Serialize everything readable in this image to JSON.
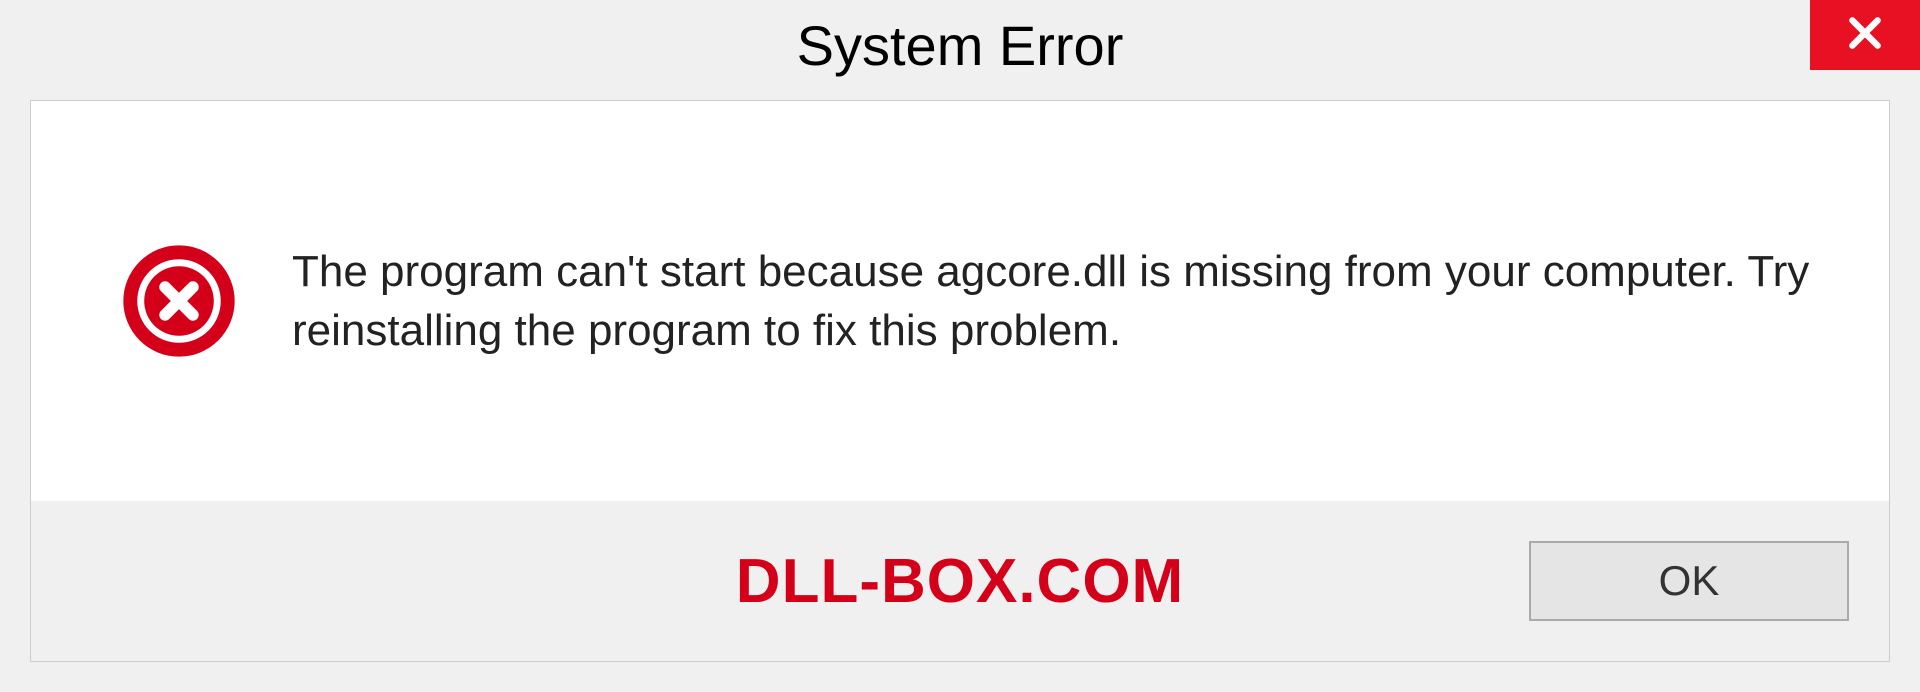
{
  "dialog": {
    "title": "System Error",
    "message": "The program can't start because agcore.dll is missing from your computer. Try reinstalling the program to fix this problem.",
    "ok_label": "OK"
  },
  "watermark": "DLL-BOX.COM",
  "colors": {
    "close_bg": "#e81123",
    "error_red": "#d4001a"
  }
}
